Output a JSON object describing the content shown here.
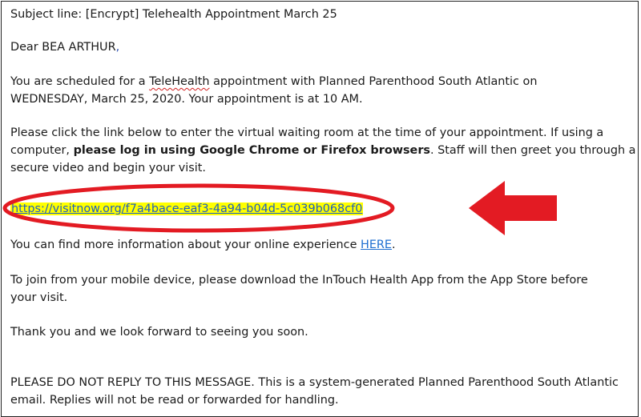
{
  "email": {
    "subject": "Subject line: [Encrypt] Telehealth Appointment March 25",
    "greeting_prefix": "Dear BEA ARTHUR",
    "greeting_suffix": ",",
    "p1": {
      "line1_a": "You are scheduled for a ",
      "line1_word": "TeleHealth",
      "line1_b": " appointment with Planned Parenthood South Atlantic on",
      "line2": "WEDNESDAY, March 25, 2020.  Your appointment is at 10 AM."
    },
    "p2": {
      "line1": "Please click the link below to enter the virtual waiting room at the time of your appointment.  If using a",
      "line2_a": "computer, ",
      "line2_bold": "please log in using Google Chrome or Firefox browsers",
      "line2_b": ".  Staff will then greet you through a",
      "line3": "secure video and begin your visit."
    },
    "link": "https://visitnow.org/f7a4bace-eaf3-4a94-b04d-5c039b068cf0",
    "p3": {
      "text": "You can find more information about your online experience ",
      "link": "HERE",
      "end": "."
    },
    "p4": {
      "line1": "To join from your mobile device, please download the InTouch Health App from the App Store before",
      "line2": "your visit."
    },
    "p5": "Thank you and we look forward to seeing you soon.",
    "p6": {
      "line1": "PLEASE DO NOT REPLY TO THIS MESSAGE. This is a system-generated Planned Parenthood South Atlantic",
      "line2": "email. Replies will not be read or forwarded for handling."
    }
  },
  "annotation": {
    "ellipse_color": "#e31b23",
    "arrow_color": "#e31b23"
  }
}
